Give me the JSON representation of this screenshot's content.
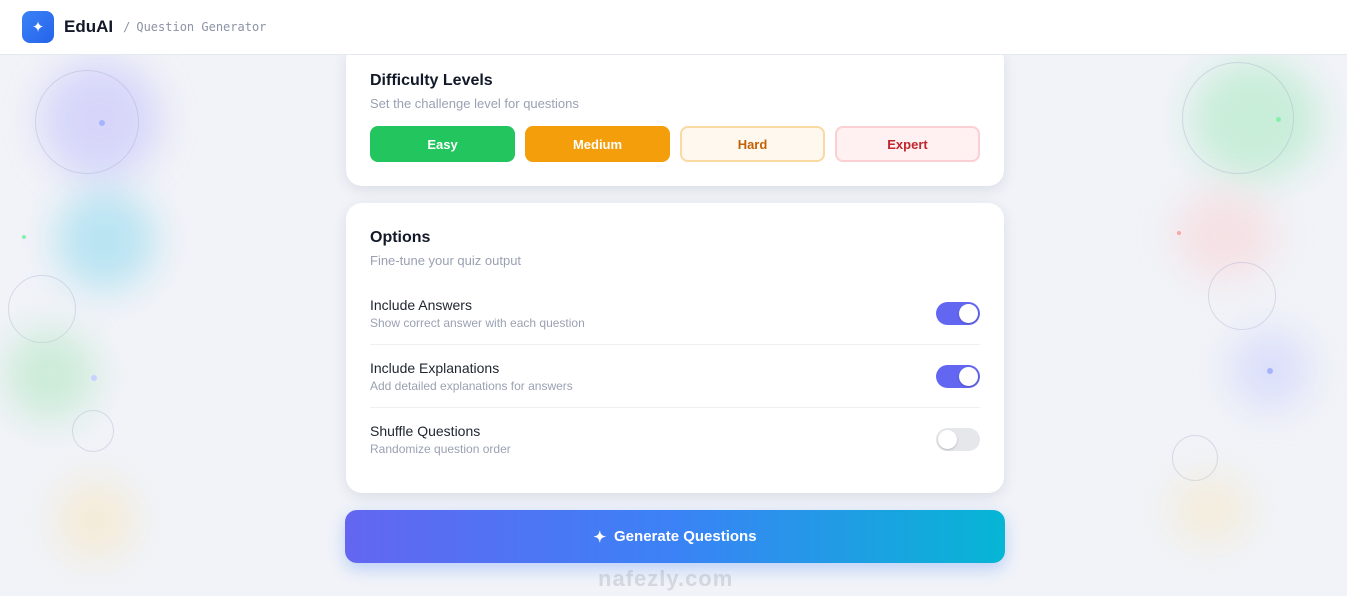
{
  "header": {
    "brand": "EduAI",
    "separator": "/",
    "breadcrumb": "Question Generator",
    "logo_icon": "sparkle-icon"
  },
  "difficulty": {
    "title": "Difficulty Levels",
    "subtitle": "Set the challenge level for questions",
    "levels": [
      {
        "label": "Easy",
        "color": "#22c55e",
        "selected": true
      },
      {
        "label": "Medium",
        "color": "#f59e0b",
        "selected": true
      },
      {
        "label": "Hard",
        "color": "#c2620a",
        "selected": false
      },
      {
        "label": "Expert",
        "color": "#c0262d",
        "selected": false
      }
    ]
  },
  "options": {
    "title": "Options",
    "subtitle": "Fine-tune your quiz output",
    "items": [
      {
        "label": "Include Answers",
        "description": "Show correct answer with each question",
        "enabled": true
      },
      {
        "label": "Include Explanations",
        "description": "Add detailed explanations for answers",
        "enabled": true
      },
      {
        "label": "Shuffle Questions",
        "description": "Randomize question order",
        "enabled": false
      }
    ]
  },
  "generate": {
    "label": "Generate Questions",
    "icon": "sparkle-icon"
  },
  "watermark": "nafezly.com",
  "colors": {
    "accent": "#6366f1",
    "gradient_start": "#6366f1",
    "gradient_end": "#06b6d4"
  }
}
